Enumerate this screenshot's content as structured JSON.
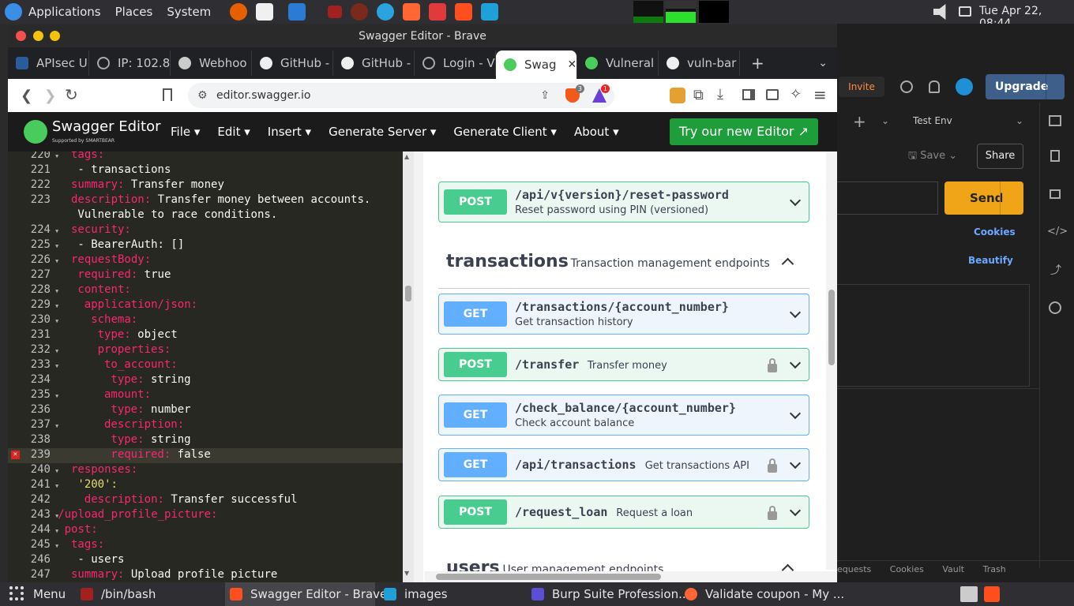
{
  "top_panel": {
    "applications": "Applications",
    "places": "Places",
    "system": "System",
    "datetime": "Tue Apr 22, 08:44"
  },
  "postman": {
    "invite": "Invite",
    "upgrade": "Upgrade",
    "env": "Test Env",
    "save": "Save",
    "share": "Share",
    "send": "Send",
    "cookies": "Cookies",
    "beautify": "Beautify",
    "footer": [
      "equests",
      "Cookies",
      "Vault",
      "Trash"
    ]
  },
  "browser": {
    "title": "Swagger Editor - Brave",
    "tabs": [
      "APIsec U",
      "IP: 102.8",
      "Webhoo",
      "GitHub -",
      "GitHub -",
      "Login - V",
      "Swag",
      "Vulneral",
      "vuln-bar"
    ],
    "active_tab_index": 6,
    "url": "editor.swagger.io",
    "brave_badge": "3",
    "alert_badge": "1"
  },
  "swagger": {
    "brand": "Swagger Editor",
    "brand_sub": "Supported by SMARTBEAR",
    "menus": [
      "File ▾",
      "Edit ▾",
      "Insert ▾",
      "Generate Server ▾",
      "Generate Client ▾",
      "About ▾"
    ],
    "try_button": "Try our new Editor ↗"
  },
  "editor": {
    "lines": [
      {
        "n": "220",
        "fold": true,
        "indent": 4,
        "k": "tags:",
        "v": ""
      },
      {
        "n": "221",
        "indent": 5,
        "k": "",
        "v": "- transactions"
      },
      {
        "n": "222",
        "indent": 4,
        "k": "summary:",
        "v": " Transfer money"
      },
      {
        "n": "223",
        "indent": 4,
        "k": "description:",
        "v": " Transfer money between accounts."
      },
      {
        "n": "",
        "indent": 5,
        "k": "",
        "v": "Vulnerable to race conditions."
      },
      {
        "n": "224",
        "fold": true,
        "indent": 4,
        "k": "security:",
        "v": ""
      },
      {
        "n": "225",
        "fold": true,
        "indent": 5,
        "k": "",
        "v": "- BearerAuth: []"
      },
      {
        "n": "226",
        "fold": true,
        "indent": 4,
        "k": "requestBody:",
        "v": ""
      },
      {
        "n": "227",
        "indent": 5,
        "k": "required:",
        "v": " true"
      },
      {
        "n": "228",
        "fold": true,
        "indent": 5,
        "k": "content:",
        "v": ""
      },
      {
        "n": "229",
        "fold": true,
        "indent": 6,
        "k": "application/json:",
        "v": ""
      },
      {
        "n": "230",
        "fold": true,
        "indent": 7,
        "k": "schema:",
        "v": ""
      },
      {
        "n": "231",
        "indent": 8,
        "k": "type:",
        "v": " object"
      },
      {
        "n": "232",
        "fold": true,
        "indent": 8,
        "k": "properties:",
        "v": ""
      },
      {
        "n": "233",
        "fold": true,
        "indent": 9,
        "k": "to_account:",
        "v": ""
      },
      {
        "n": "234",
        "indent": 10,
        "k": "type:",
        "v": " string"
      },
      {
        "n": "235",
        "fold": true,
        "indent": 9,
        "k": "amount:",
        "v": ""
      },
      {
        "n": "236",
        "indent": 10,
        "k": "type:",
        "v": " number"
      },
      {
        "n": "237",
        "fold": true,
        "indent": 9,
        "k": "description:",
        "v": ""
      },
      {
        "n": "238",
        "indent": 10,
        "k": "type:",
        "v": " string"
      },
      {
        "n": "239",
        "error": true,
        "indent": 10,
        "k": "required:",
        "v": " false"
      },
      {
        "n": "240",
        "fold": true,
        "indent": 4,
        "k": "responses:",
        "v": ""
      },
      {
        "n": "241",
        "fold": true,
        "indent": 5,
        "k": "'200':",
        "v": "",
        "str": true
      },
      {
        "n": "242",
        "indent": 6,
        "k": "description:",
        "v": " Transfer successful"
      },
      {
        "n": "243",
        "fold": true,
        "indent": 2,
        "k": "",
        "v": "/upload_profile_picture:"
      },
      {
        "n": "244",
        "fold": true,
        "indent": 3,
        "k": "post:",
        "v": ""
      },
      {
        "n": "245",
        "fold": true,
        "indent": 4,
        "k": "tags:",
        "v": ""
      },
      {
        "n": "246",
        "indent": 5,
        "k": "",
        "v": "- users"
      },
      {
        "n": "247",
        "indent": 4,
        "k": "summary:",
        "v": " Upload profile picture"
      }
    ]
  },
  "preview": {
    "ops_top": [
      {
        "method": "POST",
        "path": "/api/v{version}/reset-password",
        "summary": "Reset password using PIN (versioned)"
      }
    ],
    "tag_transactions": {
      "name": "transactions",
      "desc": "Transaction management endpoints"
    },
    "ops": [
      {
        "method": "GET",
        "path": "/transactions/{account_number}",
        "summary": "Get transaction history",
        "lock": false
      },
      {
        "method": "POST",
        "path": "/transfer",
        "summary": "Transfer money",
        "lock": true
      },
      {
        "method": "GET",
        "path": "/check_balance/{account_number}",
        "summary": "Check account balance",
        "lock": false
      },
      {
        "method": "GET",
        "path": "/api/transactions",
        "summary": "Get transactions API",
        "lock": true
      },
      {
        "method": "POST",
        "path": "/request_loan",
        "summary": "Request a loan",
        "lock": true
      }
    ],
    "tag_users": {
      "name": "users",
      "desc": "User management endpoints"
    }
  },
  "taskbar": {
    "menu": "Menu",
    "items": [
      "/bin/bash",
      "Swagger Editor - Brave",
      "images",
      "Burp Suite Profession...",
      "Validate coupon - My ..."
    ]
  }
}
